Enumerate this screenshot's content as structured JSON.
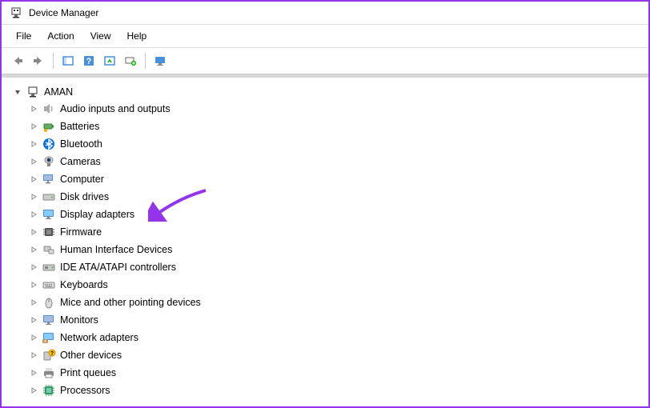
{
  "window": {
    "title": "Device Manager"
  },
  "menubar": {
    "items": [
      "File",
      "Action",
      "View",
      "Help"
    ]
  },
  "tree": {
    "root": {
      "label": "AMAN",
      "expanded": true
    },
    "nodes": [
      {
        "label": "Audio inputs and outputs",
        "icon": "speaker"
      },
      {
        "label": "Batteries",
        "icon": "battery"
      },
      {
        "label": "Bluetooth",
        "icon": "bluetooth"
      },
      {
        "label": "Cameras",
        "icon": "camera"
      },
      {
        "label": "Computer",
        "icon": "computer"
      },
      {
        "label": "Disk drives",
        "icon": "disk"
      },
      {
        "label": "Display adapters",
        "icon": "display"
      },
      {
        "label": "Firmware",
        "icon": "firmware"
      },
      {
        "label": "Human Interface Devices",
        "icon": "hid"
      },
      {
        "label": "IDE ATA/ATAPI controllers",
        "icon": "ide"
      },
      {
        "label": "Keyboards",
        "icon": "keyboard"
      },
      {
        "label": "Mice and other pointing devices",
        "icon": "mouse"
      },
      {
        "label": "Monitors",
        "icon": "monitor"
      },
      {
        "label": "Network adapters",
        "icon": "network"
      },
      {
        "label": "Other devices",
        "icon": "other"
      },
      {
        "label": "Print queues",
        "icon": "printer"
      },
      {
        "label": "Processors",
        "icon": "processor"
      }
    ]
  },
  "annotation": {
    "target": "Display adapters",
    "color": "#9333ea"
  }
}
